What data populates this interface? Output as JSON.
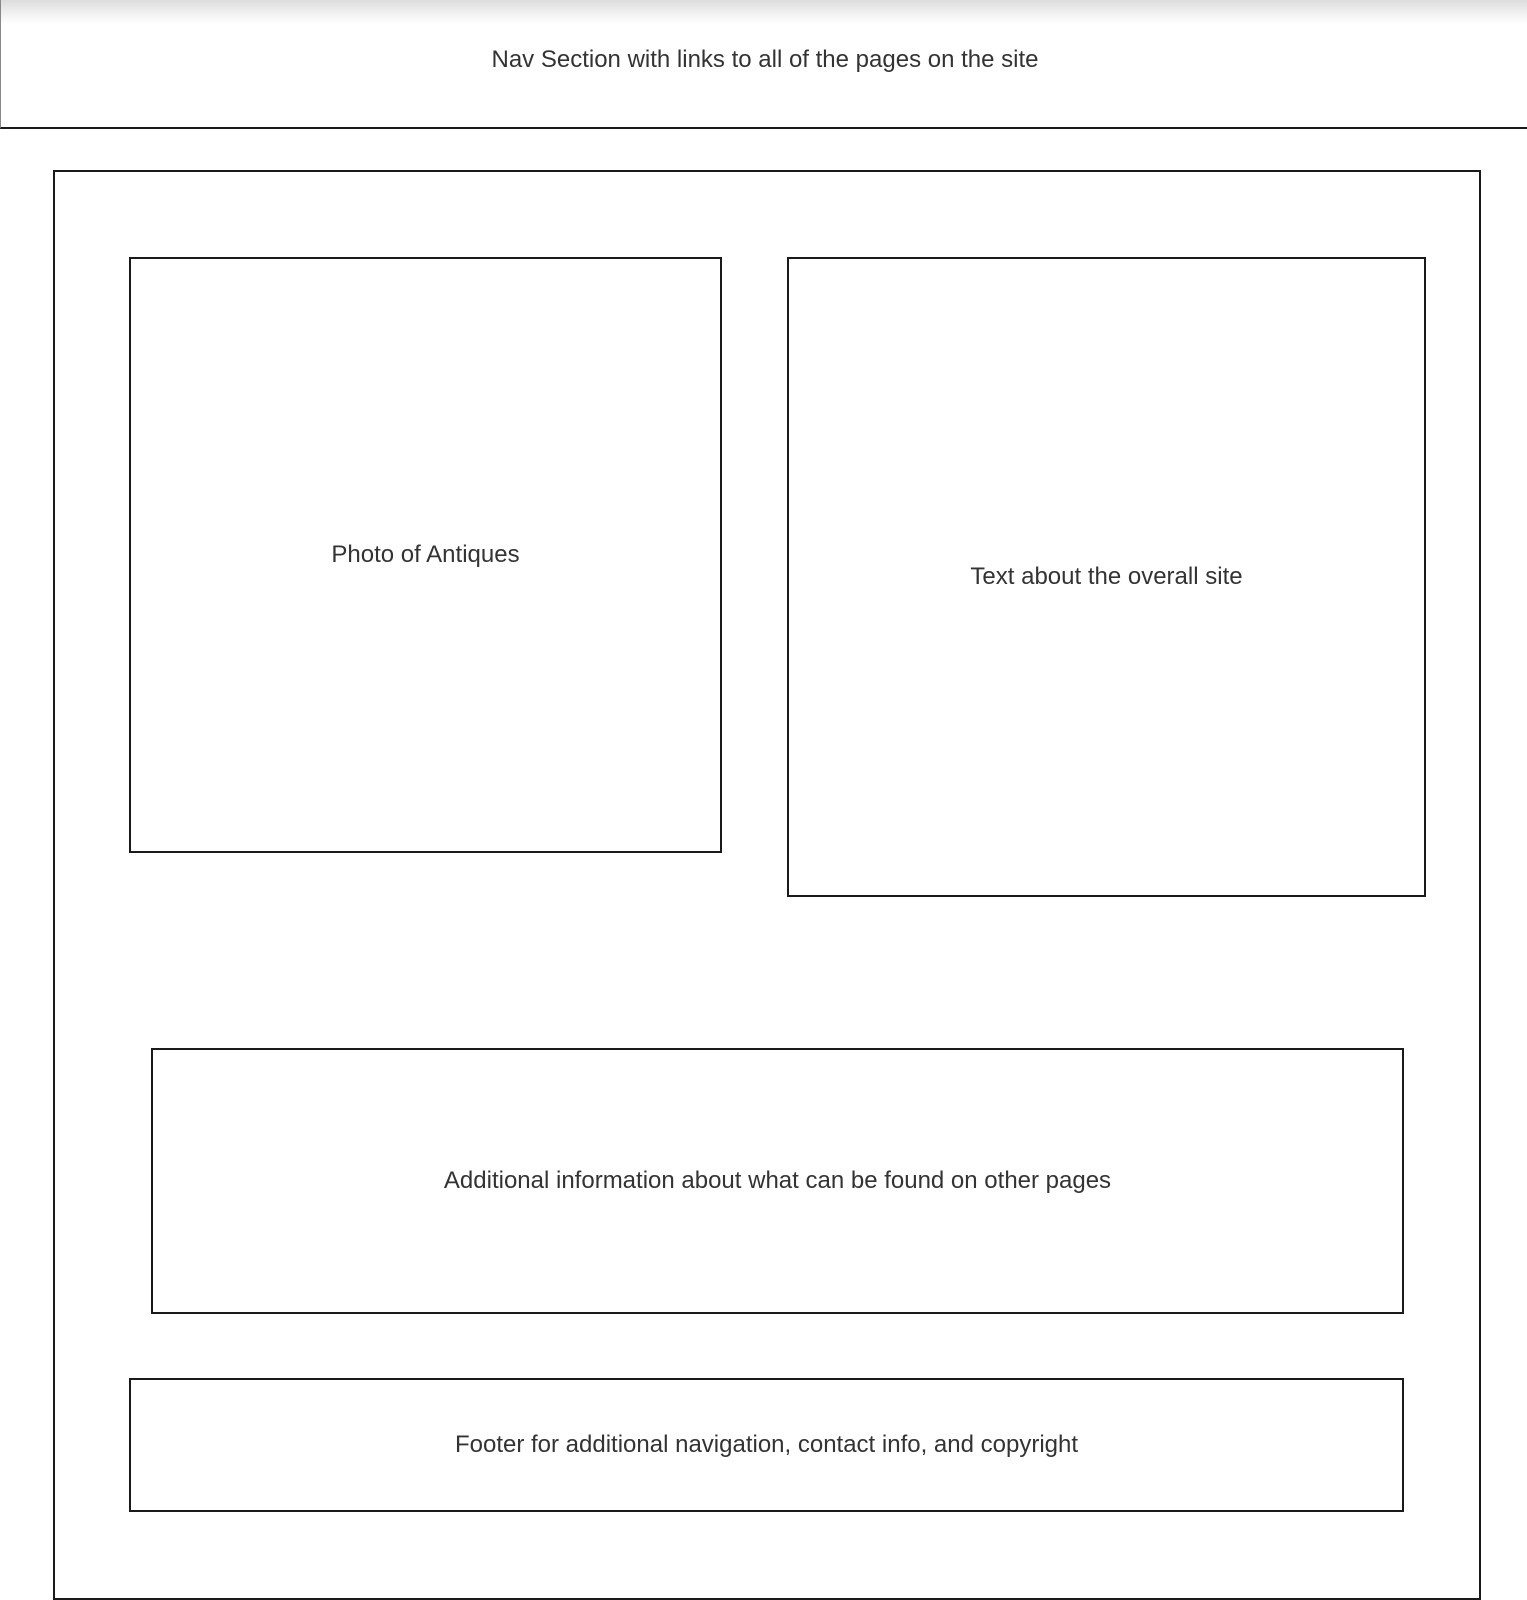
{
  "nav": {
    "label": "Nav Section with links to all of the pages on the site"
  },
  "content": {
    "photo": {
      "label": "Photo of Antiques"
    },
    "site_text": {
      "label": "Text about the overall site"
    },
    "additional_info": {
      "label": "Additional information about what can be found on other pages"
    },
    "footer": {
      "label": "Footer for additional navigation, contact info, and copyright"
    }
  }
}
